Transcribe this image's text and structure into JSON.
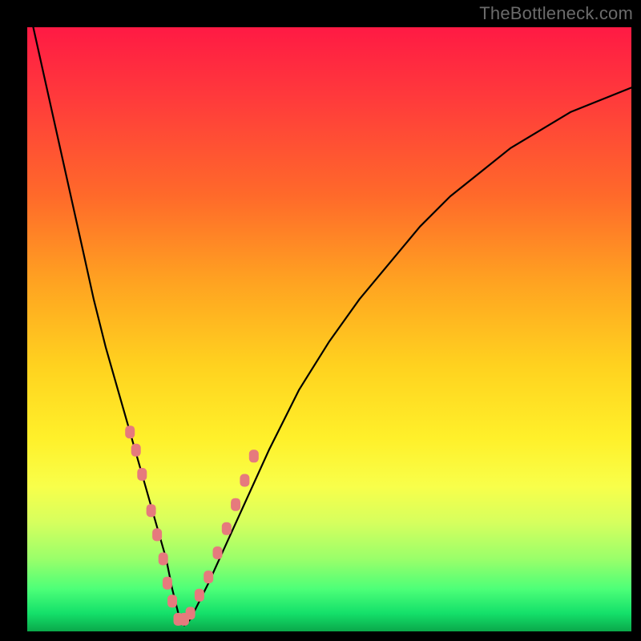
{
  "watermark": "TheBottleneck.com",
  "chart_data": {
    "type": "line",
    "title": "",
    "xlabel": "",
    "ylabel": "",
    "xlim": [
      0,
      100
    ],
    "ylim": [
      0,
      100
    ],
    "grid": false,
    "series": [
      {
        "name": "bottleneck-curve",
        "x": [
          1,
          3,
          5,
          7,
          9,
          11,
          13,
          15,
          17,
          19,
          21,
          23,
          24,
          25,
          26,
          27,
          30,
          35,
          40,
          45,
          50,
          55,
          60,
          65,
          70,
          75,
          80,
          85,
          90,
          95,
          100
        ],
        "values": [
          100,
          91,
          82,
          73,
          64,
          55,
          47,
          40,
          33,
          26,
          19,
          12,
          7,
          3,
          1,
          2,
          8,
          19,
          30,
          40,
          48,
          55,
          61,
          67,
          72,
          76,
          80,
          83,
          86,
          88,
          90
        ]
      }
    ],
    "markers": {
      "name": "highlighted-points",
      "color": "#e67a7d",
      "points": [
        {
          "x": 17,
          "y": 33
        },
        {
          "x": 18,
          "y": 30
        },
        {
          "x": 19,
          "y": 26
        },
        {
          "x": 20.5,
          "y": 20
        },
        {
          "x": 21.5,
          "y": 16
        },
        {
          "x": 22.5,
          "y": 12
        },
        {
          "x": 23.2,
          "y": 8
        },
        {
          "x": 24,
          "y": 5
        },
        {
          "x": 25,
          "y": 2
        },
        {
          "x": 26,
          "y": 2
        },
        {
          "x": 27,
          "y": 3
        },
        {
          "x": 28.5,
          "y": 6
        },
        {
          "x": 30,
          "y": 9
        },
        {
          "x": 31.5,
          "y": 13
        },
        {
          "x": 33,
          "y": 17
        },
        {
          "x": 34.5,
          "y": 21
        },
        {
          "x": 36,
          "y": 25
        },
        {
          "x": 37.5,
          "y": 29
        }
      ]
    }
  }
}
